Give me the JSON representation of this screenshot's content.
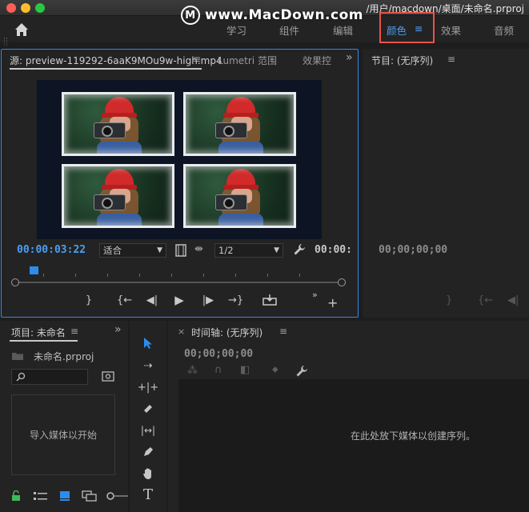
{
  "window": {
    "title_path": "/用户/macdown/桌面/未命名.prproj",
    "watermark": "www.MacDown.com",
    "watermark_logo": "M"
  },
  "workspaces": {
    "tabs": [
      "学习",
      "组件",
      "编辑",
      "颜色",
      "效果",
      "音频"
    ],
    "active": "颜色",
    "active_menu_icon": "≡"
  },
  "source_panel": {
    "tab_label": "源: preview-119292-6aaK9MOu9w-high.mp4",
    "tab_menu": "≡",
    "tab2": "Lumetri 范围",
    "tab3": "效果控",
    "overflow": "»",
    "timecode": "00:00:03:22",
    "zoom_select": "适合",
    "resolution_select": "1/2",
    "end_timecode": "00:00:"
  },
  "program_panel": {
    "tab_label": "节目: (无序列)",
    "tab_menu": "≡",
    "timecode": "00;00;00;00"
  },
  "project_panel": {
    "tab_label": "项目: 未命名",
    "tab_menu": "≡",
    "overflow": "»",
    "file_name": "未命名.prproj",
    "import_hint": "导入媒体以开始"
  },
  "timeline_panel": {
    "close": "×",
    "tab_label": "时间轴: (无序列)",
    "tab_menu": "≡",
    "timecode": "00;00;00;00",
    "drop_hint": "在此处放下媒体以创建序列。"
  },
  "icons": {
    "home": "home-icon",
    "accent_color": "#2d8ceb",
    "highlight_color": "#e8534a"
  }
}
